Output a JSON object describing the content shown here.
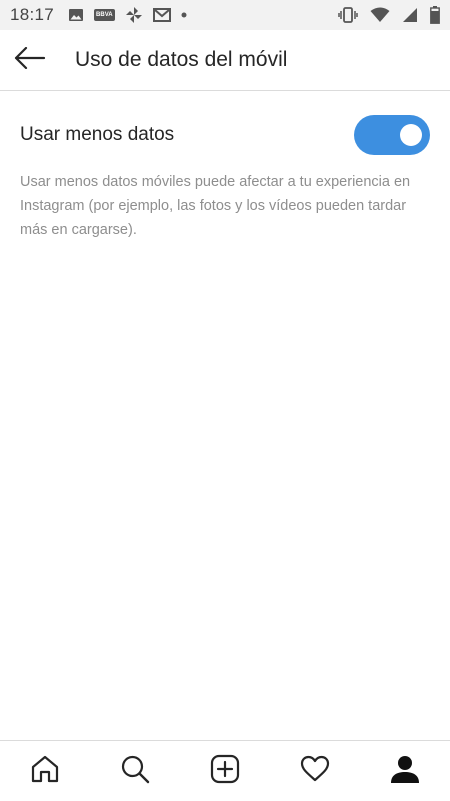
{
  "status_bar": {
    "time": "18:17",
    "left_icons": [
      "image-icon",
      "bbva-icon",
      "pinwheel-icon",
      "gmail-icon",
      "dot-icon"
    ],
    "bbva_label": "BBVA",
    "right_icons": [
      "vibrate-icon",
      "wifi-icon",
      "signal-icon",
      "battery-icon"
    ]
  },
  "header": {
    "back_icon": "arrow-left-icon",
    "title": "Uso de datos del móvil"
  },
  "settings": {
    "less_data": {
      "label": "Usar menos datos",
      "enabled": true,
      "description": "Usar menos datos móviles puede afectar a tu experiencia en Instagram (por ejemplo, las fotos y los vídeos pueden tardar más en cargarse)."
    }
  },
  "colors": {
    "toggle_on": "#3d8fe0",
    "text_primary": "#262626",
    "text_secondary": "#8e8e8e",
    "status_bar_bg": "#f2f2f2"
  },
  "bottom_nav": {
    "items": [
      "home-icon",
      "search-icon",
      "add-post-icon",
      "heart-icon",
      "profile-icon"
    ],
    "active": "profile-icon"
  }
}
